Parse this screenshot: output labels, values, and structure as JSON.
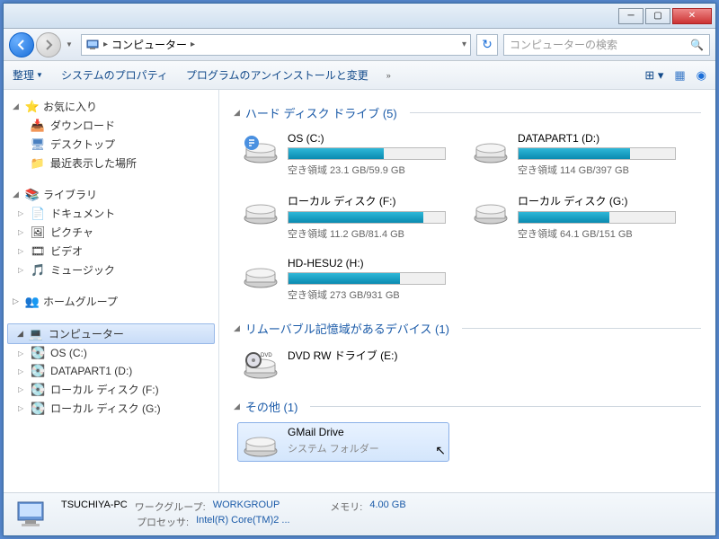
{
  "breadcrumb": {
    "location": "コンピューター"
  },
  "search": {
    "placeholder": "コンピューターの検索"
  },
  "toolbar": {
    "organize": "整理",
    "properties": "システムのプロパティ",
    "uninstall": "プログラムのアンインストールと変更"
  },
  "sidebar": {
    "favorites": {
      "label": "お気に入り",
      "items": [
        {
          "label": "ダウンロード",
          "icon": "download"
        },
        {
          "label": "デスクトップ",
          "icon": "desktop"
        },
        {
          "label": "最近表示した場所",
          "icon": "recent"
        }
      ]
    },
    "libraries": {
      "label": "ライブラリ",
      "items": [
        {
          "label": "ドキュメント",
          "icon": "doc"
        },
        {
          "label": "ピクチャ",
          "icon": "pic"
        },
        {
          "label": "ビデオ",
          "icon": "vid"
        },
        {
          "label": "ミュージック",
          "icon": "mus"
        }
      ]
    },
    "homegroup": {
      "label": "ホームグループ"
    },
    "computer": {
      "label": "コンピューター",
      "items": [
        {
          "label": "OS (C:)"
        },
        {
          "label": "DATAPART1 (D:)"
        },
        {
          "label": "ローカル ディスク (F:)"
        },
        {
          "label": "ローカル ディスク (G:)"
        }
      ]
    }
  },
  "sections": {
    "hdd": {
      "title": "ハード ディスク ドライブ (5)"
    },
    "removable": {
      "title": "リムーバブル記憶域があるデバイス (1)"
    },
    "other": {
      "title": "その他 (1)"
    }
  },
  "drives": {
    "hdd": [
      {
        "name": "OS (C:)",
        "space": "空き領域 23.1 GB/59.9 GB",
        "fill": 61
      },
      {
        "name": "DATAPART1 (D:)",
        "space": "空き領域 114 GB/397 GB",
        "fill": 71
      },
      {
        "name": "ローカル ディスク (F:)",
        "space": "空き領域 11.2 GB/81.4 GB",
        "fill": 86
      },
      {
        "name": "ローカル ディスク (G:)",
        "space": "空き領域 64.1 GB/151 GB",
        "fill": 58
      },
      {
        "name": "HD-HESU2 (H:)",
        "space": "空き領域 273 GB/931 GB",
        "fill": 71
      }
    ],
    "removable": [
      {
        "name": "DVD RW ドライブ (E:)"
      }
    ],
    "other": [
      {
        "name": "GMail Drive",
        "sub": "システム フォルダー"
      }
    ]
  },
  "footer": {
    "pc_name": "TSUCHIYA-PC",
    "workgroup_label": "ワークグループ:",
    "workgroup": "WORKGROUP",
    "memory_label": "メモリ:",
    "memory": "4.00 GB",
    "cpu_label": "プロセッサ:",
    "cpu": "Intel(R) Core(TM)2 ..."
  }
}
